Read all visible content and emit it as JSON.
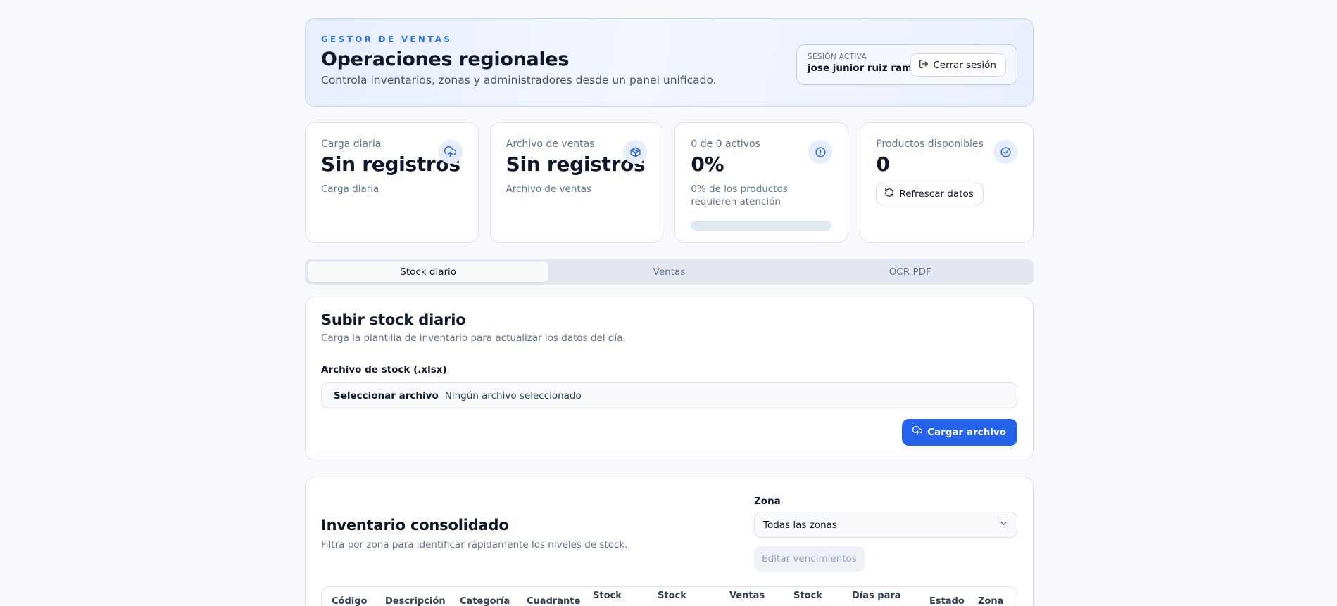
{
  "header": {
    "eyebrow": "GESTOR DE VENTAS",
    "title": "Operaciones regionales",
    "subtitle": "Controla inventarios, zonas y administradores desde un panel unificado.",
    "session_label": "SESIÓN ACTIVA",
    "session_user": "jose junior ruiz ramos",
    "logout_label": "Cerrar sesión"
  },
  "cards": [
    {
      "title": "Carga diaria",
      "value": "Sin registros",
      "desc": "Carga diaria",
      "icon": "cloud-upload-icon"
    },
    {
      "title": "Archivo de ventas",
      "value": "Sin registros",
      "desc": "Archivo de ventas",
      "icon": "box-icon"
    },
    {
      "title": "0 de 0 activos",
      "value": "0%",
      "desc": "0% de los productos requieren atención",
      "icon": "alert-circle-icon",
      "progress": 0
    },
    {
      "title": "Productos disponibles",
      "value": "0",
      "button": "Refrescar datos",
      "icon": "check-badge-icon"
    }
  ],
  "tabs": [
    {
      "label": "Stock diario",
      "active": true
    },
    {
      "label": "Ventas",
      "active": false
    },
    {
      "label": "OCR PDF",
      "active": false
    }
  ],
  "upload": {
    "title": "Subir stock diario",
    "desc": "Carga la plantilla de inventario para actualizar los datos del día.",
    "field_label": "Archivo de stock (.xlsx)",
    "file_button": "Seleccionar archivo",
    "file_name": "Ningún archivo seleccionado",
    "submit": "Cargar archivo"
  },
  "inventory": {
    "title": "Inventario consolidado",
    "desc": "Filtra por zona para identificar rápidamente los niveles de stock.",
    "zone_label": "Zona",
    "zone_value": "Todas las zonas",
    "edit_button": "Editar vencimientos",
    "columns": [
      "Código",
      "Descripción",
      "Categoría",
      "Cuadrante",
      "Stock",
      "Stock",
      "Ventas",
      "Stock",
      "Días para",
      "Estado",
      "Zona"
    ]
  },
  "colors": {
    "accent": "#2563eb",
    "accent_soft": "#e6edfb"
  }
}
